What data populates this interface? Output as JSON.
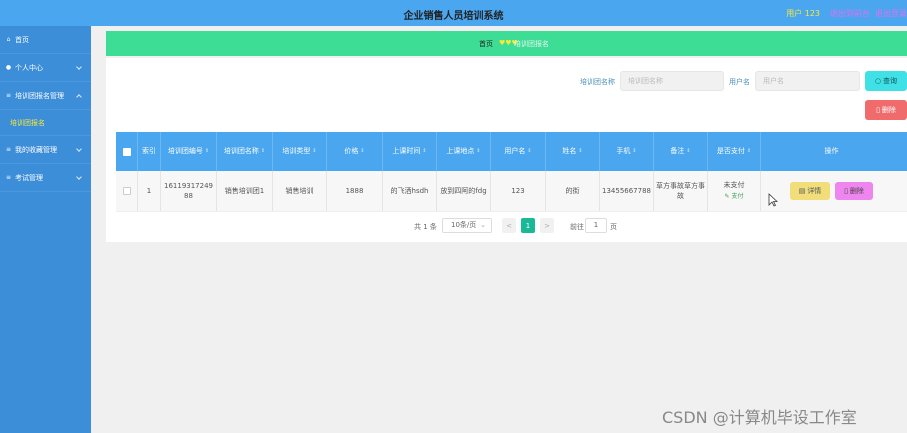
{
  "header": {
    "title": "企业销售人员培训系统",
    "user": "用户 123",
    "logout": "退出到前台",
    "exit": "退出登录"
  },
  "sidebar": {
    "items": [
      {
        "label": "首页",
        "icon": "home-icon"
      },
      {
        "label": "个人中心",
        "icon": "user-icon"
      },
      {
        "label": "培训团报名管理",
        "icon": "list-icon"
      },
      {
        "label": "培训团报名",
        "icon": ""
      },
      {
        "label": "我的收藏管理",
        "icon": "list-icon"
      },
      {
        "label": "考试管理",
        "icon": "list-icon"
      }
    ]
  },
  "breadcrumb": {
    "home": "首页",
    "hearts": "♥♥♥",
    "current": "培训团报名"
  },
  "search": {
    "label1": "培训团名称",
    "placeholder1": "培训团名称",
    "label2": "用户名",
    "placeholder2": "用户名",
    "search_button": "查询",
    "delete_button": "删除"
  },
  "table": {
    "columns": [
      "索引",
      "培训团编号",
      "培训团名称",
      "培训类型",
      "价格",
      "上课时间",
      "上课地点",
      "用户名",
      "姓名",
      "手机",
      "备注",
      "是否支付",
      "操作"
    ],
    "rows": [
      {
        "index": "1",
        "code": "1611931724988",
        "name": "销售培训团1",
        "type": "销售培训",
        "price": "1888",
        "time": "的飞洒hsdh",
        "place": "放到四阿的fdg",
        "username": "123",
        "realname": "的街",
        "phone": "13455667788",
        "remark": "草方事故草方事故",
        "paid": "未支付",
        "pay_link": "支付",
        "detail_button": "详情",
        "delete_button": "删除"
      }
    ]
  },
  "pagination": {
    "total": "共 1 条",
    "page_size": "10条/页",
    "prev": "<",
    "current_page": "1",
    "next": ">",
    "goto_label": "前往",
    "goto_value": "1",
    "page_suffix": "页"
  },
  "watermark": "CSDN @计算机毕设工作室",
  "colors": {
    "header": "#49a6ef",
    "sidebar": "#3c8ed8",
    "breadcrumb": "#3edd95",
    "accent_yellow": "#f6e93c",
    "accent_pink": "#e46ef0"
  }
}
